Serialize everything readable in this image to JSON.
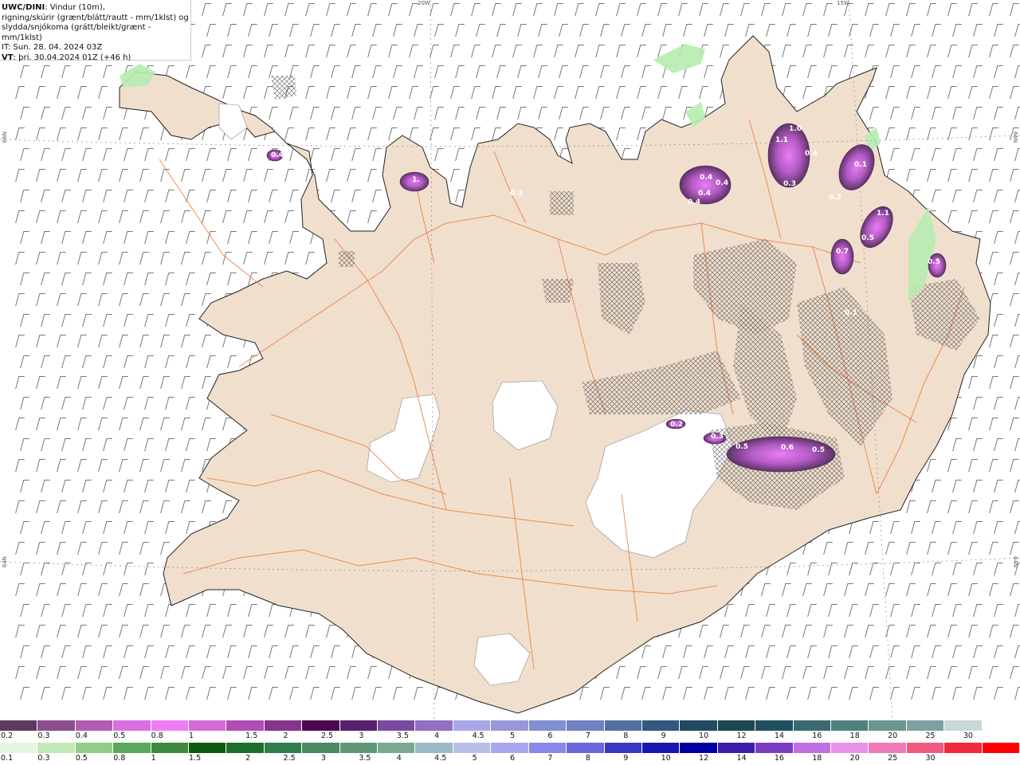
{
  "header": {
    "model": "UWC/DINI",
    "line1": ": Vindur (10m),",
    "line2": "rigning/skúrir (grænt/blátt/rautt - mm/1klst) og",
    "line3": "slydda/snjókoma (grátt/bleikt/grænt - mm/1klst)",
    "it": "IT: Sun. 28. 04. 2024 03Z",
    "vt_label": "VT",
    "vt": ": þri. 30.04.2024 01Z (+46 h)"
  },
  "graticule": {
    "lon_20w": "20W",
    "lon_15w": "15W",
    "lat_66n_left": "66N",
    "lat_66n_right": "66N",
    "lat_64n_left": "64N",
    "lat_64n_right": "64N"
  },
  "precip_labels": [
    "0.4",
    "1.",
    "0.3",
    "1.0",
    "1.1",
    "0.4",
    "0.3",
    "0.4",
    "0.4",
    "0.4",
    "0.4",
    "0.3",
    "1.1",
    "0.5",
    "0.7",
    "0.5",
    "0.2",
    "0.3",
    "0.5",
    "0.6",
    "0.5",
    "0.1",
    "0.1"
  ],
  "snow_scale": {
    "colors": [
      "#5e3a5f",
      "#8a4e8c",
      "#b05db3",
      "#d86fe0",
      "#f07cf5",
      "#d46ad8",
      "#b04db6",
      "#86348c",
      "#4e0550",
      "#5a1e6e",
      "#7a4aa0",
      "#9070c0",
      "#a8a8e8",
      "#9898d8",
      "#8090d0",
      "#7080c0",
      "#50709e",
      "#34587e",
      "#204a60",
      "#1c4850",
      "#205060",
      "#3a6a70",
      "#50807e",
      "#6a9690",
      "#7fa0a0",
      "#c8d8d8",
      "#ffffff"
    ],
    "ticks": [
      "0.2",
      "0.3",
      "0.4",
      "0.5",
      "0.8",
      "1",
      "1.5",
      "2",
      "2.5",
      "3",
      "3.5",
      "4",
      "4.5",
      "5",
      "6",
      "7",
      "8",
      "9",
      "10",
      "12",
      "14",
      "16",
      "18",
      "20",
      "25",
      "30"
    ]
  },
  "rain_scale": {
    "colors": [
      "#e6f6e0",
      "#c3e8b8",
      "#8fce88",
      "#5aa85a",
      "#3d8a3d",
      "#0e5a0e",
      "#1e6e2e",
      "#2e7e4a",
      "#4a8a60",
      "#5e9878",
      "#7aa890",
      "#9cb8c8",
      "#b8c0e8",
      "#a8a8f0",
      "#8a88e8",
      "#6a68d8",
      "#3838c0",
      "#1818b0",
      "#0000a0",
      "#3a1ea8",
      "#7a3ec0",
      "#c070e0",
      "#e894e8",
      "#f07ab8",
      "#f05a80",
      "#f02a3a",
      "#ff0000"
    ],
    "ticks": [
      "0.1",
      "0.3",
      "0.5",
      "0.8",
      "1",
      "1.5",
      "2",
      "2.5",
      "3",
      "3.5",
      "4",
      "4.5",
      "5",
      "6",
      "7",
      "8",
      "9",
      "10",
      "12",
      "14",
      "16",
      "18",
      "20",
      "25",
      "30"
    ]
  },
  "colors": {
    "land": "#f1dfcd",
    "roads": "#ee7a3c",
    "ice": "#ffffff",
    "snow_dark": "#6b3f72",
    "snow_light": "#d26ee6"
  }
}
